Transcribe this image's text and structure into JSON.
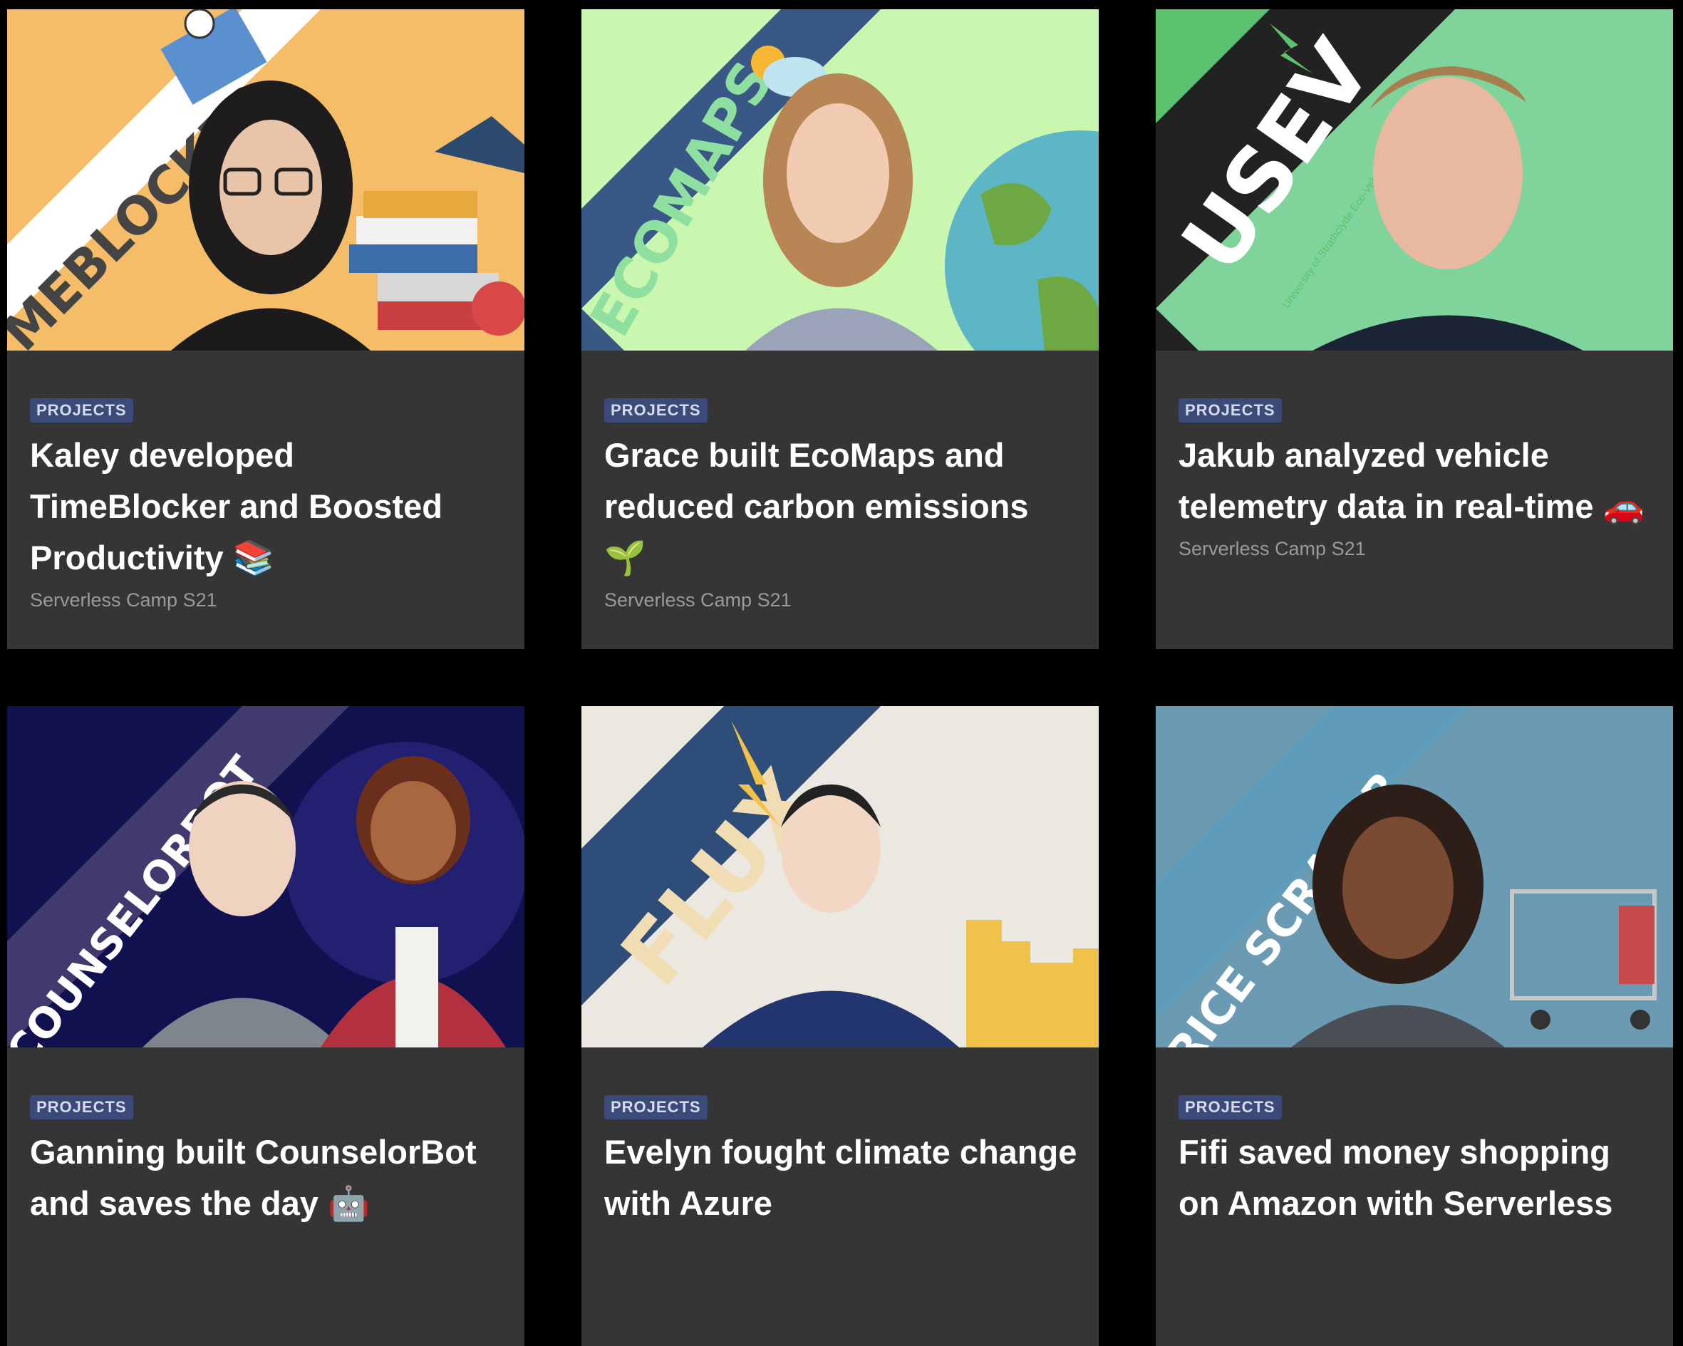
{
  "cards": [
    {
      "tag": "PROJECTS",
      "title": "Kaley developed TimeBlocker and Boosted Productivity 📚",
      "meta": "Serverless Camp S21",
      "banner": "MEBLOCKER",
      "colors": {
        "bg": "#f5bd68",
        "stripe": "#ffffff",
        "text": "#444444"
      }
    },
    {
      "tag": "PROJECTS",
      "title": "Grace built EcoMaps and reduced carbon emissions 🌱",
      "meta": "Serverless Camp S21",
      "banner": "ECOMAPS",
      "colors": {
        "bg": "#c9f7b0",
        "stripe": "#3a5885",
        "text": "#8fe0a0"
      }
    },
    {
      "tag": "PROJECTS",
      "title": "Jakub analyzed vehicle telemetry data in real-time 🚗",
      "meta": "Serverless Camp S21",
      "banner": "USEV",
      "banner_sub": "University of Strathclyde Eco-Vehicle",
      "colors": {
        "bg": "#7fd49b",
        "stripe": "#222222",
        "text": "#ffffff",
        "accent": "#5cc36d"
      }
    },
    {
      "tag": "PROJECTS",
      "title": "Ganning built CounselorBot and saves the day 🤖",
      "meta": "",
      "banner": "COUNSELORBOT",
      "colors": {
        "bg": "#12114f",
        "stripe": "#403a6e",
        "text": "#ffffff"
      }
    },
    {
      "tag": "PROJECTS",
      "title": "Evelyn fought climate change with Azure",
      "meta": "",
      "banner": "FLUX",
      "colors": {
        "bg": "#ebe7e1",
        "stripe": "#2f4d79",
        "text": "#f1ddb4",
        "accent": "#f1c24a"
      }
    },
    {
      "tag": "PROJECTS",
      "title": "Fifi saved money shopping on Amazon with Serverless",
      "meta": "",
      "banner": "PRICE SCRAPER",
      "colors": {
        "bg": "#6b9bb2",
        "stripe": "#5e9cb9",
        "text": "#ffffff"
      }
    }
  ]
}
